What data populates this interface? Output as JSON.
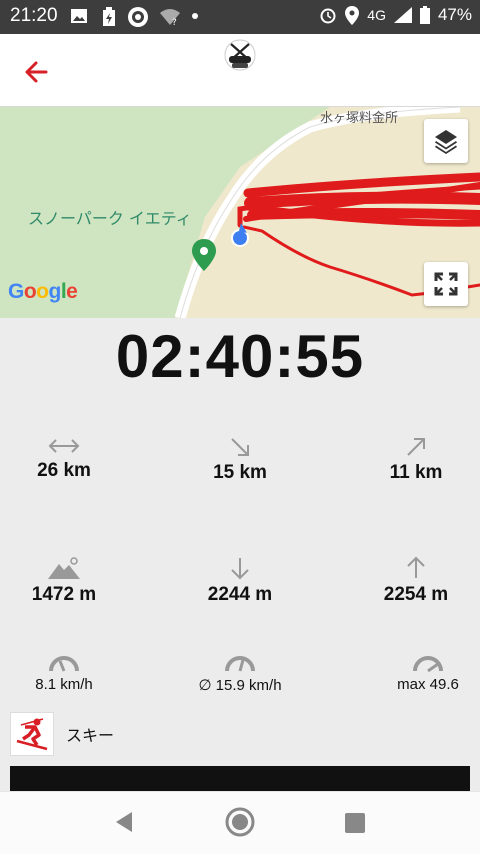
{
  "status_bar": {
    "time": "21:20",
    "network": "4G",
    "battery": "47%"
  },
  "map": {
    "place_label": "水ヶ塚料金所",
    "poi_label": "スノーパーク イエティ",
    "google_logo": "Google",
    "track_color": "#e01b1b"
  },
  "timer": "02:40:55",
  "stats": {
    "distance": {
      "icon": "distance-arrows-icon",
      "value": "26 km"
    },
    "downhill_distance": {
      "icon": "downhill-arrow-icon",
      "value": "15 km"
    },
    "uphill_distance": {
      "icon": "uphill-arrow-icon",
      "value": "11 km"
    },
    "altitude": {
      "icon": "mountain-icon",
      "value": "1472 m"
    },
    "descent": {
      "icon": "down-arrow-icon",
      "value": "2244 m"
    },
    "ascent": {
      "icon": "up-arrow-icon",
      "value": "2254 m"
    },
    "speed_current": {
      "icon": "speedometer-icon",
      "value": "8.1 km/h"
    },
    "speed_avg": {
      "icon": "speedometer-icon",
      "value": "∅ 15.9 km/h"
    },
    "speed_max": {
      "icon": "speedometer-icon",
      "value": "max 49.6"
    }
  },
  "activity": {
    "label": "スキー",
    "icon": "skier-icon"
  },
  "colors": {
    "accent": "#d81f26",
    "background": "#ececec"
  }
}
